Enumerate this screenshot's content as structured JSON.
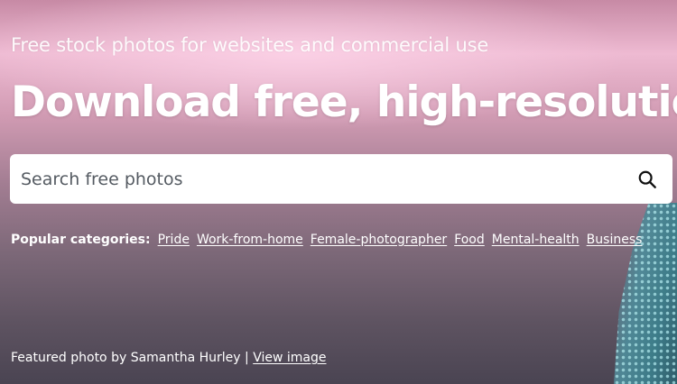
{
  "hero": {
    "tagline": "Free stock photos for websites and commercial use",
    "headline": "Download free, high-resolution images"
  },
  "search": {
    "placeholder": "Search free photos",
    "value": "",
    "icon": "search-icon"
  },
  "categories": {
    "label": "Popular categories:",
    "items": [
      "Pride",
      "Work-from-home",
      "Female-photographer",
      "Food",
      "Mental-health",
      "Business"
    ]
  },
  "credit": {
    "text": "Featured photo by Samantha Hurley |",
    "link": "View image"
  },
  "colors": {
    "text": "#ffffff",
    "search_bg": "#ffffff",
    "placeholder": "#555b62"
  }
}
